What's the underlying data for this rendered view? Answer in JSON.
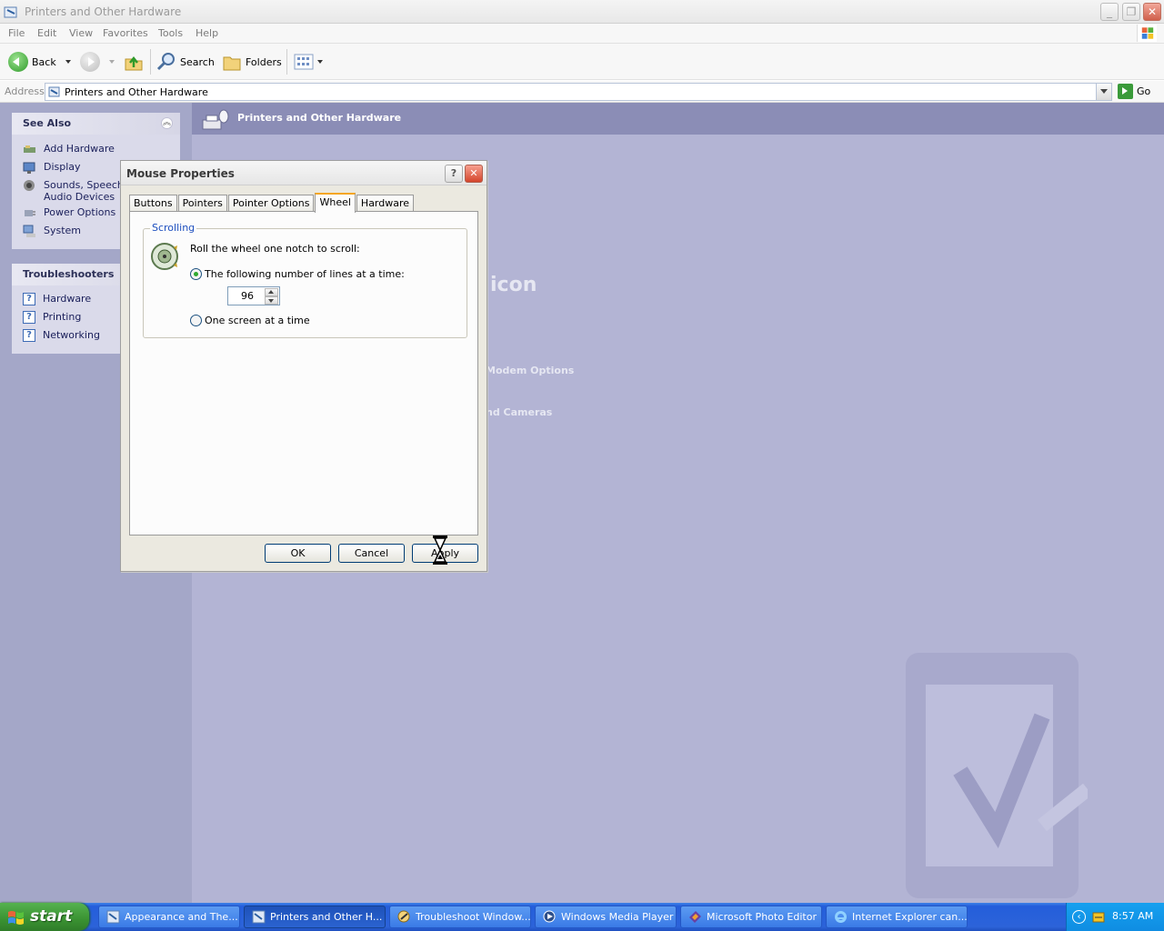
{
  "window": {
    "title": "Printers and Other Hardware",
    "controls": [
      "minimize-icon",
      "maximize-icon",
      "close-icon"
    ]
  },
  "menu": {
    "items": [
      "File",
      "Edit",
      "View",
      "Favorites",
      "Tools",
      "Help"
    ]
  },
  "toolbar": {
    "back_label": "Back",
    "search_label": "Search",
    "folders_label": "Folders"
  },
  "address": {
    "label": "Address",
    "value": "Printers and Other Hardware",
    "go_label": "Go"
  },
  "see_also": {
    "title": "See Also",
    "items": [
      {
        "label": "Add Hardware",
        "icon": "hardware-icon"
      },
      {
        "label": "Display",
        "icon": "display-icon"
      },
      {
        "label": "Sounds, Speech, Audio Devices",
        "icon": "speaker-icon"
      },
      {
        "label": "Power Options",
        "icon": "power-icon"
      },
      {
        "label": "System",
        "icon": "computer-icon"
      }
    ]
  },
  "troubleshooters": {
    "title": "Troubleshooters",
    "items": [
      "Hardware",
      "Printing",
      "Networking"
    ]
  },
  "main": {
    "header_title": "Printers and Other Hardware",
    "ghost_texts": [
      "icon",
      "Modem Options",
      "nd Cameras"
    ]
  },
  "dialog": {
    "title": "Mouse Properties",
    "tabs": [
      "Buttons",
      "Pointers",
      "Pointer Options",
      "Wheel",
      "Hardware"
    ],
    "active_tab": "Wheel",
    "group_label": "Scrolling",
    "instruction": "Roll the wheel one notch to scroll:",
    "option_lines": "The following number of lines at a time:",
    "option_lines_selected": true,
    "lines_value": "96",
    "option_screen": "One screen at a time",
    "option_screen_selected": false,
    "ok_label": "OK",
    "cancel_label": "Cancel",
    "apply_label": "Apply"
  },
  "taskbar": {
    "start_label": "start",
    "tasks": [
      {
        "label": "Appearance and The...",
        "active": false
      },
      {
        "label": "Printers and Other H...",
        "active": true
      },
      {
        "label": "Troubleshoot Window...",
        "active": false
      },
      {
        "label": "Windows Media Player",
        "active": false
      },
      {
        "label": "Microsoft Photo Editor",
        "active": false
      },
      {
        "label": "Internet Explorer can...",
        "active": false
      }
    ],
    "clock": "8:57 AM"
  },
  "colors": {
    "dim_overlay": "#b3b4d4",
    "taskbar_blue": "#245edb",
    "start_green": "#3a9232",
    "tab_highlight": "#f5a623"
  }
}
